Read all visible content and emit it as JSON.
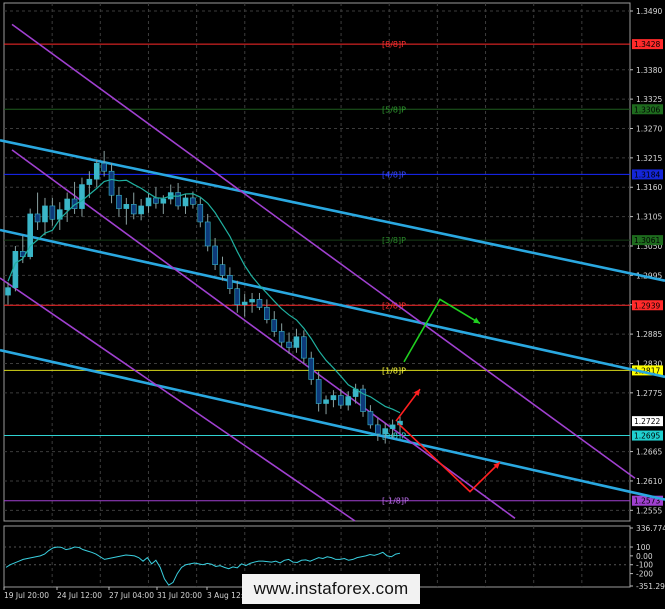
{
  "chart_data": [
    {
      "type": "candlestick",
      "price_axis": {
        "ticks": [
          "1.3490",
          "1.3380",
          "1.3325",
          "1.3270",
          "1.3215",
          "1.3160",
          "1.3105",
          "1.3050",
          "1.2995",
          "1.2940",
          "1.2885",
          "1.2830",
          "1.2775",
          "1.2665",
          "1.2610",
          "1.2555"
        ],
        "ylim": [
          1.2535,
          1.3505
        ]
      },
      "time_axis": {
        "labels": [
          "19 Jul 20:00",
          "24 Jul 12:00",
          "27 Jul 04:00",
          "31 Jul 20:00",
          "3 Aug 12:00"
        ]
      },
      "grid": true,
      "murrey_levels": [
        {
          "label": "[8/8]P",
          "price": 1.3428,
          "tag": "1.3428",
          "color": "#ff2a2a",
          "label_color": "#ff3030",
          "tag_bg": "#ff2a2a"
        },
        {
          "label": "[5/8]P",
          "price": 1.3306,
          "tag": "1.3306",
          "color": "#1f5e1f",
          "label_color": "#2f9a2f",
          "tag_bg": "#1e6b1e"
        },
        {
          "label": "[4/8]P",
          "price": 1.3184,
          "tag": "1.3184",
          "color": "#1828ff",
          "label_color": "#3a4cff",
          "tag_bg": "#1426d8"
        },
        {
          "label": "[3/8]P",
          "price": 1.3061,
          "tag": "1.3061",
          "color": "#173d17",
          "label_color": "#2a8a2a",
          "tag_bg": "#1e6b1e"
        },
        {
          "label": "[2/8]P",
          "price": 1.2939,
          "tag": "1.2939",
          "color": "#ff2a2a",
          "label_color": "#ff3030",
          "tag_bg": "#ff2a2a"
        },
        {
          "label": "[1/8]P",
          "price": 1.2817,
          "tag": "1.2817",
          "color": "#d8d81a",
          "label_color": "#ffff40",
          "tag_bg": "#ffff00"
        },
        {
          "label": "[0/8]P",
          "price": 1.2695,
          "tag": "1.2695",
          "color": "#2fd2d2",
          "label_color": "#40e0e0",
          "tag_bg": "#20d0d0"
        },
        {
          "label": "[-1/8]P",
          "price": 1.2573,
          "tag": "1.2573",
          "color": "#a040d0",
          "label_color": "#c070f0",
          "tag_bg": "#a040d0"
        }
      ],
      "current_price": {
        "value": 1.2722,
        "tag": "1.2722"
      },
      "trend_channels": [
        {
          "color": "#2aa8e0",
          "points": [
            [
              0,
              1.3248
            ],
            [
              665,
              1.2985
            ]
          ]
        },
        {
          "color": "#2aa8e0",
          "points": [
            [
              0,
              1.308
            ],
            [
              665,
              1.2805
            ]
          ]
        },
        {
          "color": "#2aa8e0",
          "points": [
            [
              0,
              1.2855
            ],
            [
              665,
              1.2575
            ]
          ]
        },
        {
          "color": "#a040d0",
          "points": [
            [
              12,
              1.3465
            ],
            [
              635,
              1.2615
            ]
          ]
        },
        {
          "color": "#a040d0",
          "points": [
            [
              12,
              1.323
            ],
            [
              515,
              1.254
            ]
          ]
        },
        {
          "color": "#a040d0",
          "points": [
            [
              0,
              1.299
            ],
            [
              355,
              1.2535
            ]
          ]
        }
      ],
      "ma_line": {
        "color": "#20b0a0"
      },
      "forecast_arrows": [
        {
          "color": "#20d020",
          "points": [
            [
              404,
              1.2833
            ],
            [
              440,
              1.295
            ],
            [
              480,
              1.2905
            ]
          ]
        },
        {
          "color": "#ff2020",
          "points": [
            [
              396,
              1.2722
            ],
            [
              420,
              1.2782
            ]
          ]
        },
        {
          "color": "#ff2020",
          "points": [
            [
              398,
              1.2718
            ],
            [
              470,
              1.259
            ],
            [
              500,
              1.2645
            ]
          ]
        }
      ],
      "candles": [
        [
          1.2958,
          1.2982,
          1.294,
          1.2972
        ],
        [
          1.2972,
          1.305,
          1.2965,
          1.304
        ],
        [
          1.304,
          1.307,
          1.3018,
          1.303
        ],
        [
          1.303,
          1.312,
          1.3025,
          1.311
        ],
        [
          1.311,
          1.315,
          1.308,
          1.3095
        ],
        [
          1.3095,
          1.314,
          1.307,
          1.3125
        ],
        [
          1.3125,
          1.314,
          1.3088,
          1.31
        ],
        [
          1.31,
          1.3132,
          1.308,
          1.3118
        ],
        [
          1.3118,
          1.315,
          1.3095,
          1.3138
        ],
        [
          1.3138,
          1.317,
          1.311,
          1.312
        ],
        [
          1.312,
          1.3178,
          1.3105,
          1.3165
        ],
        [
          1.3165,
          1.319,
          1.314,
          1.3175
        ],
        [
          1.3175,
          1.3212,
          1.316,
          1.3205
        ],
        [
          1.3205,
          1.3228,
          1.318,
          1.319
        ],
        [
          1.319,
          1.3205,
          1.313,
          1.3145
        ],
        [
          1.3145,
          1.316,
          1.3105,
          1.312
        ],
        [
          1.312,
          1.314,
          1.309,
          1.3128
        ],
        [
          1.3128,
          1.315,
          1.31,
          1.311
        ],
        [
          1.311,
          1.3138,
          1.3098,
          1.3125
        ],
        [
          1.3125,
          1.315,
          1.3112,
          1.314
        ],
        [
          1.314,
          1.316,
          1.312,
          1.313
        ],
        [
          1.313,
          1.3145,
          1.311,
          1.3138
        ],
        [
          1.3138,
          1.3165,
          1.3128,
          1.315
        ],
        [
          1.315,
          1.3168,
          1.3118,
          1.3125
        ],
        [
          1.3125,
          1.3148,
          1.311,
          1.314
        ],
        [
          1.314,
          1.3152,
          1.312,
          1.3128
        ],
        [
          1.3128,
          1.314,
          1.3085,
          1.3095
        ],
        [
          1.3095,
          1.311,
          1.304,
          1.305
        ],
        [
          1.305,
          1.3065,
          1.3005,
          1.3015
        ],
        [
          1.3015,
          1.303,
          1.2985,
          1.2995
        ],
        [
          1.2995,
          1.301,
          1.296,
          1.297
        ],
        [
          1.297,
          1.2985,
          1.2925,
          1.294
        ],
        [
          1.294,
          1.296,
          1.2918,
          1.2945
        ],
        [
          1.2945,
          1.2962,
          1.2925,
          1.295
        ],
        [
          1.295,
          1.2962,
          1.293,
          1.2935
        ],
        [
          1.2935,
          1.295,
          1.2905,
          1.2912
        ],
        [
          1.2912,
          1.2928,
          1.288,
          1.289
        ],
        [
          1.289,
          1.2905,
          1.286,
          1.287
        ],
        [
          1.287,
          1.2888,
          1.2848,
          1.286
        ],
        [
          1.286,
          1.2895,
          1.285,
          1.288
        ],
        [
          1.288,
          1.2892,
          1.283,
          1.284
        ],
        [
          1.284,
          1.2852,
          1.279,
          1.28
        ],
        [
          1.28,
          1.2815,
          1.274,
          1.2755
        ],
        [
          1.2755,
          1.277,
          1.2735,
          1.2762
        ],
        [
          1.2762,
          1.278,
          1.2748,
          1.277
        ],
        [
          1.277,
          1.2782,
          1.2745,
          1.2752
        ],
        [
          1.2752,
          1.2778,
          1.2742,
          1.2768
        ],
        [
          1.2768,
          1.2792,
          1.2755,
          1.2782
        ],
        [
          1.2782,
          1.279,
          1.273,
          1.274
        ],
        [
          1.274,
          1.2752,
          1.2708,
          1.2715
        ],
        [
          1.2715,
          1.2728,
          1.2685,
          1.2698
        ],
        [
          1.2698,
          1.2718,
          1.268,
          1.2708
        ],
        [
          1.2708,
          1.2725,
          1.269,
          1.2715
        ],
        [
          1.2715,
          1.2732,
          1.27,
          1.2722
        ]
      ]
    },
    {
      "type": "line",
      "indicator_ticks": [
        "336.7745",
        "100",
        "0.00",
        "-100",
        "-200",
        "-351.294"
      ],
      "ylim": [
        -351.294,
        336.7745
      ],
      "color": "#3ad0e0",
      "values": [
        -130,
        -100,
        -80,
        -60,
        -40,
        -30,
        -20,
        -10,
        0,
        20,
        60,
        90,
        100,
        95,
        70,
        80,
        100,
        95,
        70,
        55,
        40,
        20,
        -10,
        -40,
        -30,
        -20,
        -10,
        0,
        10,
        5,
        0,
        -20,
        -60,
        -20,
        -90,
        -50,
        -130,
        -260,
        -330,
        -300,
        -200,
        -130,
        -100,
        -90,
        -80,
        -90,
        -100,
        -85,
        -95,
        -120,
        -110,
        -130,
        -145,
        -125,
        -135,
        -90,
        -110,
        -85,
        -70,
        -60,
        -60,
        -65,
        -70,
        -60,
        -80,
        -50,
        -40,
        -70,
        -75,
        -50,
        -45,
        -60,
        -40,
        -20,
        -30,
        -10,
        -20,
        -40,
        -40,
        -30,
        -50,
        -40,
        -20,
        -10,
        0,
        15,
        5,
        20,
        40,
        0,
        -10,
        20,
        30
      ]
    }
  ],
  "watermark": {
    "text": "www.instaforex.com"
  }
}
